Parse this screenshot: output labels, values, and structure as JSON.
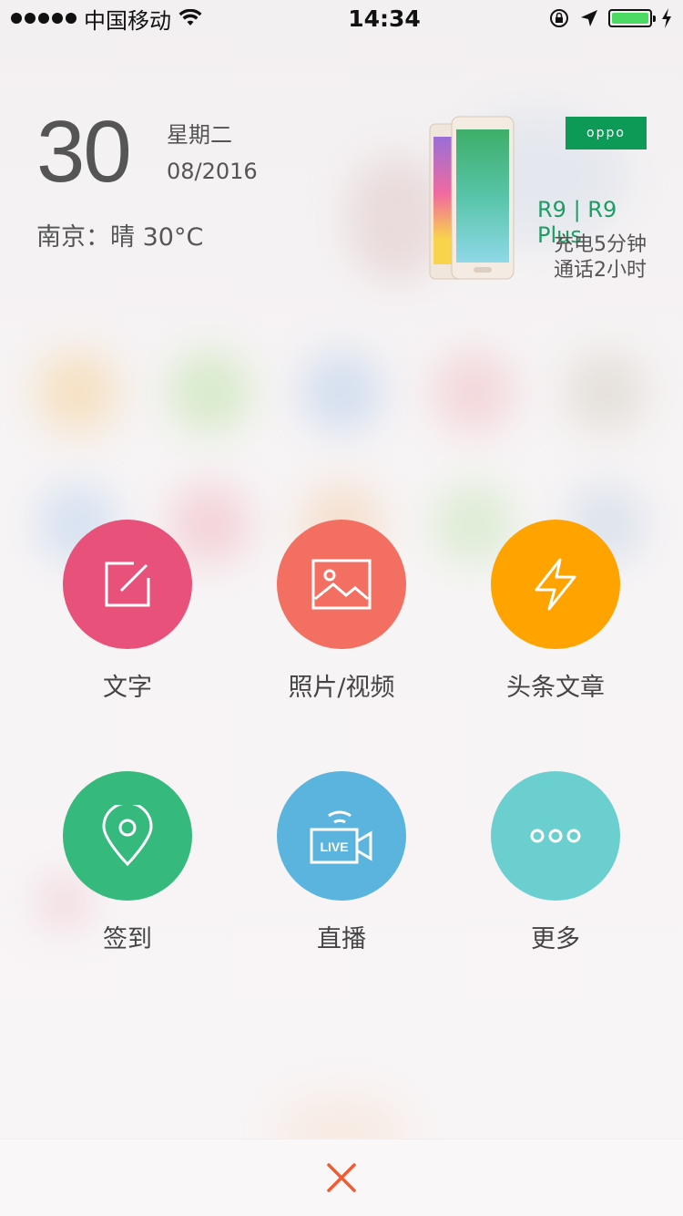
{
  "status_bar": {
    "carrier": "中国移动",
    "time": "14:34",
    "battery_level": 1.0
  },
  "date_widget": {
    "day": "30",
    "weekday": "星期二",
    "month_year": "08/2016",
    "weather": "南京：晴 30°C"
  },
  "ad": {
    "brand": "oppo",
    "model": "R9 | R9 Plus",
    "line1": "充电5分钟",
    "line2": "通话2小时",
    "brand_color": "#0c9a56"
  },
  "actions": [
    {
      "label": "文字",
      "color": "#e8527a",
      "icon": "edit-icon"
    },
    {
      "label": "照片/视频",
      "color": "#f26f61",
      "icon": "image-icon"
    },
    {
      "label": "头条文章",
      "color": "#fea300",
      "icon": "lightning-icon"
    },
    {
      "label": "签到",
      "color": "#36b97c",
      "icon": "location-pin-icon"
    },
    {
      "label": "直播",
      "color": "#5bb4dd",
      "icon": "live-camera-icon"
    },
    {
      "label": "更多",
      "color": "#6ccfcf",
      "icon": "more-icon"
    }
  ],
  "close": {
    "color": "#f05b34",
    "icon": "close-icon"
  }
}
